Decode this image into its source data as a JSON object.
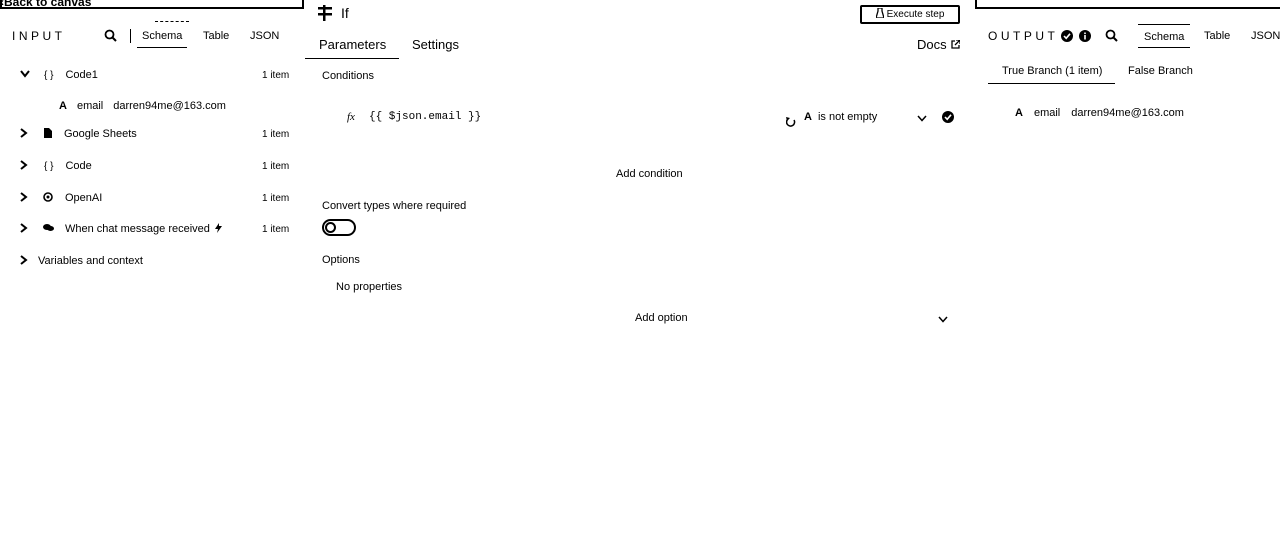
{
  "header": {
    "back_label": "Back to canvas",
    "node_title": "If",
    "execute_label": "Execute step"
  },
  "input": {
    "title": "INPUT",
    "tabs": [
      "Schema",
      "Table",
      "JSON"
    ],
    "tree": [
      {
        "label": "Code1",
        "count": "1 item"
      },
      {
        "field_type": "A",
        "field": "email",
        "value": "darren94me@163.com"
      },
      {
        "label": "Google Sheets",
        "count": "1 item"
      },
      {
        "label": "Code",
        "count": "1 item"
      },
      {
        "label": "OpenAI",
        "count": "1 item"
      },
      {
        "label": "When chat message received",
        "count": "1 item"
      },
      {
        "label": "Variables and context"
      }
    ]
  },
  "node": {
    "tabs": [
      "Parameters",
      "Settings"
    ],
    "docs_label": "Docs",
    "conditions_label": "Conditions",
    "condition": {
      "fx": "fx",
      "expression": "{{ $json.email }}",
      "type_icon": "A",
      "operator": "is not empty"
    },
    "add_condition_label": "Add condition",
    "convert_label": "Convert types where required",
    "options_label": "Options",
    "no_properties_label": "No properties",
    "add_option_label": "Add option"
  },
  "output": {
    "title": "OUTPUT",
    "tabs": [
      "Schema",
      "Table",
      "JSON"
    ],
    "branches": [
      "True Branch (1 item)",
      "False Branch"
    ],
    "field_type": "A",
    "field": "email",
    "value": "darren94me@163.com"
  }
}
